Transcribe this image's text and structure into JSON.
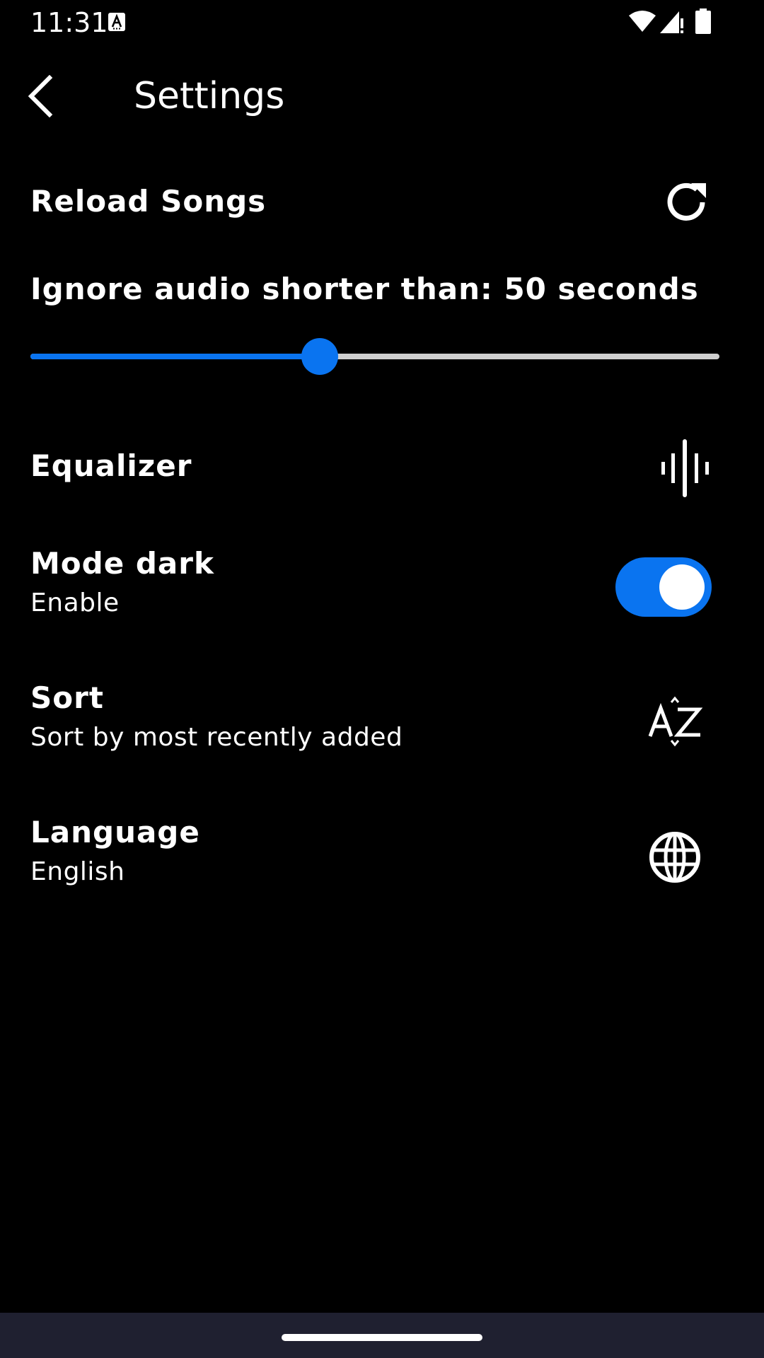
{
  "status_bar": {
    "time": "11:31",
    "icons": [
      "notification-a-icon",
      "wifi-icon",
      "signal-icon",
      "battery-icon"
    ]
  },
  "app_bar": {
    "title": "Settings",
    "back_icon": "chevron-left-icon"
  },
  "settings": {
    "reload": {
      "title": "Reload Songs",
      "icon": "refresh-icon"
    },
    "min_duration": {
      "label": "Ignore audio shorter than: 50 seconds",
      "value_fraction": 0.42
    },
    "equalizer": {
      "title": "Equalizer",
      "icon": "waveform-icon"
    },
    "dark_mode": {
      "title": "Mode dark",
      "subtitle": "Enable",
      "enabled": true
    },
    "sort": {
      "title": "Sort",
      "subtitle": "Sort by most recently added",
      "icon": "sort-az-icon"
    },
    "language": {
      "title": "Language",
      "subtitle": "English",
      "icon": "globe-icon"
    }
  },
  "colors": {
    "background": "#000000",
    "accent": "#0a74f0",
    "track_inactive": "#cfcfcf",
    "nav_bar": "#1f2030",
    "text": "#ffffff"
  }
}
